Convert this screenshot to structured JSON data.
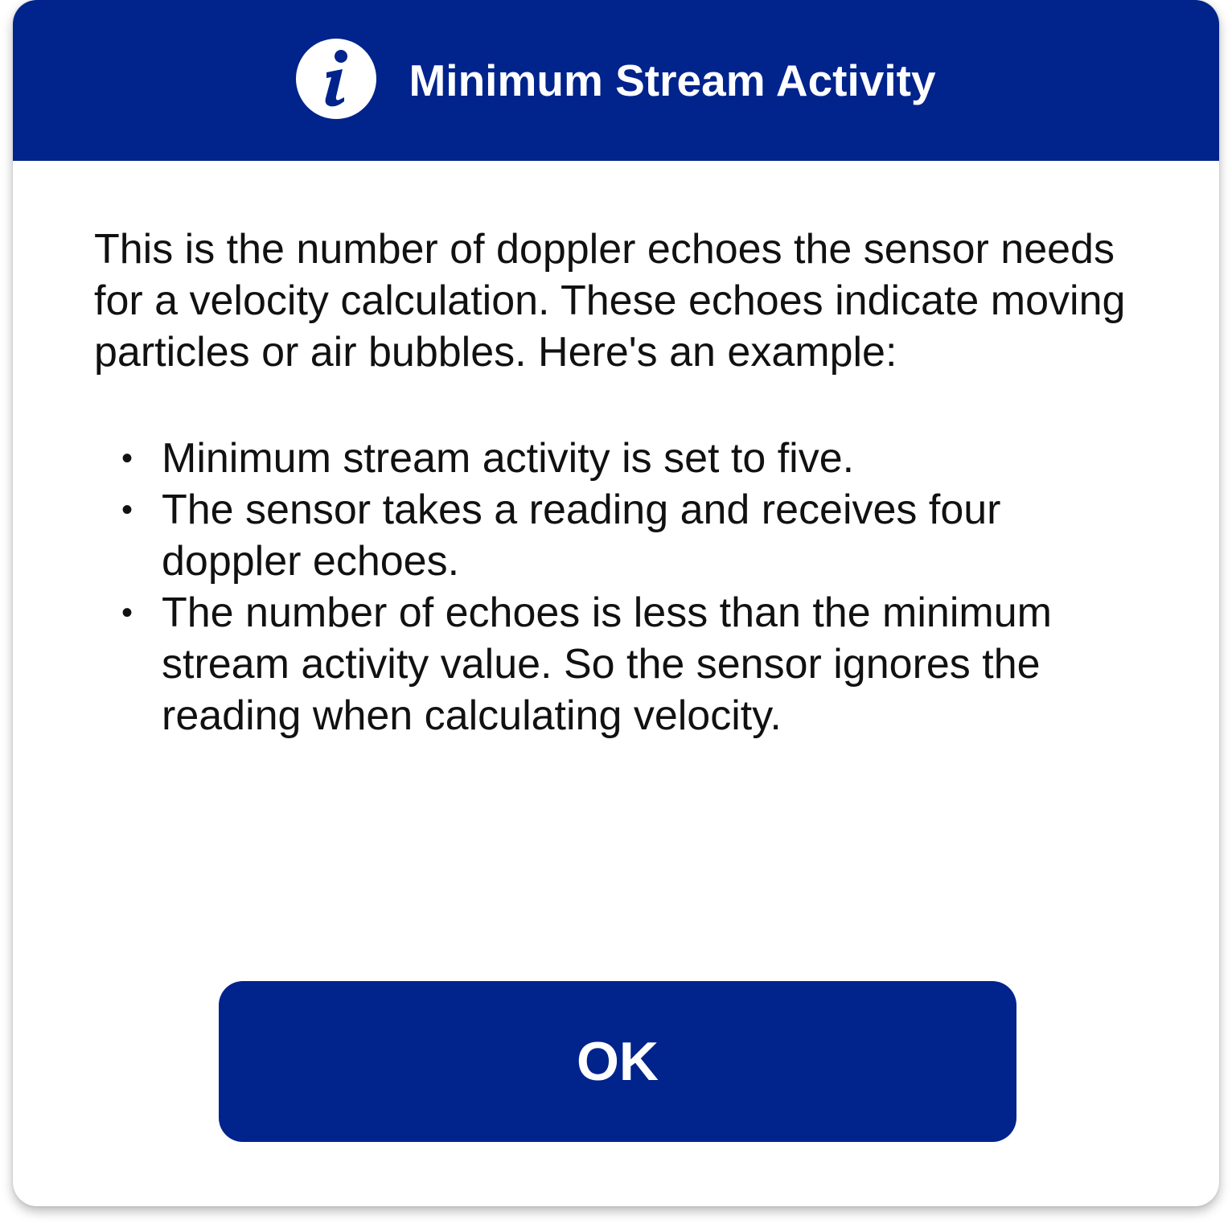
{
  "dialog": {
    "icon": "info-icon",
    "title": "Minimum Stream Activity",
    "description": "This is the number of doppler echoes the sensor needs for a velocity calculation. These echoes indicate moving particles or air bubbles. Here's an example:",
    "bullets": [
      "Minimum stream activity is set to five.",
      "The sensor takes a reading and receives four doppler echoes.",
      "The number of echoes is less than the minimum stream activity value. So the sensor ignores the reading when calculating velocity."
    ],
    "ok_label": "OK"
  },
  "colors": {
    "primary": "#00238c",
    "background": "#ffffff",
    "text": "#111111"
  }
}
